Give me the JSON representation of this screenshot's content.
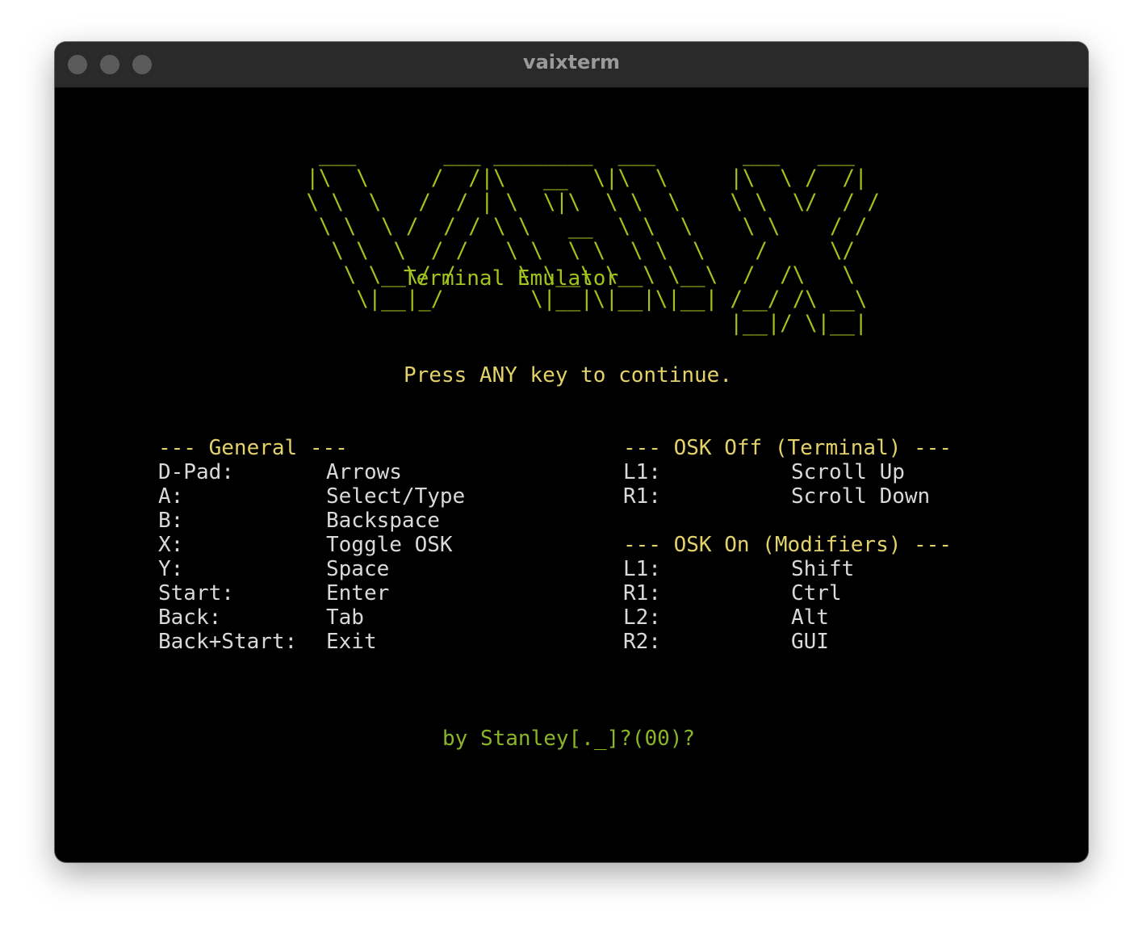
{
  "window": {
    "title": "vaixterm"
  },
  "logo": {
    "art": "  ___       ___ ________  ___       ___   ___ \n |\\  \\     /  /|\\   __  \\|\\  \\     |\\  \\ /  /|\n \\ \\  \\   /  / | \\  \\|\\  \\ \\  \\    \\ \\  \\/  / /\n  \\ \\  \\ /  / / \\ \\   __  \\ \\  \\    \\ \\    / / \n   \\ \\  \\  / /   \\ \\  \\ \\  \\ \\  \\    /     \\/  \n    \\ \\__\\/ /     \\ \\__\\ \\__\\ \\__\\  /  /\\   \\  \n     \\|__|_/       \\|__|\\|__|\\|__| /__/ /\\ __\\ \n                                   |__|/ \\|__| ",
    "subtitle": "Terminal Emulator"
  },
  "prompt": "Press ANY key to continue.",
  "general": {
    "heading": "--- General ---",
    "rows": [
      {
        "key": "D-Pad:",
        "value": "Arrows"
      },
      {
        "key": "A:",
        "value": "Select/Type"
      },
      {
        "key": "B:",
        "value": "Backspace"
      },
      {
        "key": "X:",
        "value": "Toggle OSK"
      },
      {
        "key": "Y:",
        "value": "Space"
      },
      {
        "key": "Start:",
        "value": "Enter"
      },
      {
        "key": "Back:",
        "value": "Tab"
      },
      {
        "key": "Back+Start:",
        "value": "Exit"
      }
    ]
  },
  "osk_off": {
    "heading": "--- OSK Off (Terminal) ---",
    "rows": [
      {
        "key": "L1:",
        "value": "Scroll Up"
      },
      {
        "key": "R1:",
        "value": "Scroll Down"
      }
    ]
  },
  "osk_on": {
    "heading": "--- OSK On (Modifiers) ---",
    "rows": [
      {
        "key": "L1:",
        "value": "Shift"
      },
      {
        "key": "R1:",
        "value": "Ctrl"
      },
      {
        "key": "L2:",
        "value": "Alt"
      },
      {
        "key": "R2:",
        "value": "GUI"
      }
    ]
  },
  "credit": "by Stanley[._]?(00)?",
  "colors": {
    "logo": "#a2c21c",
    "heading": "#e3d26a",
    "text": "#d9d9d9",
    "background": "#000000"
  }
}
